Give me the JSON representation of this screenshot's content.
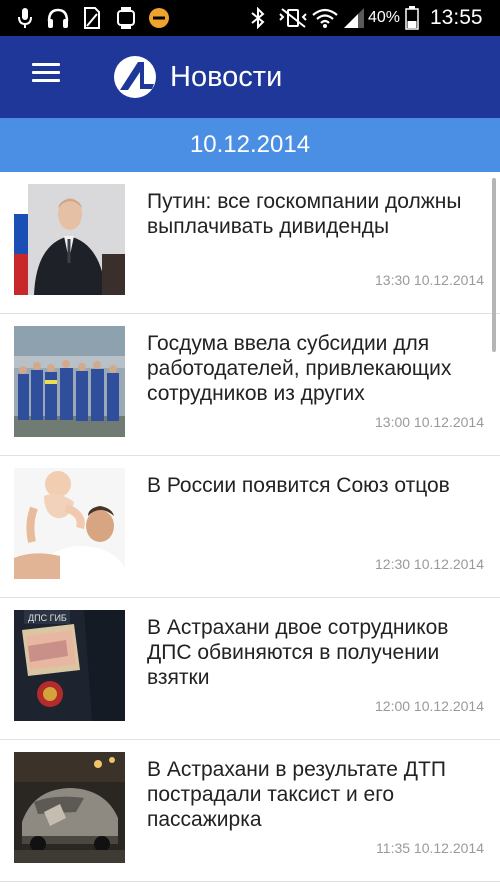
{
  "status_bar": {
    "battery": "40%",
    "time": "13:55",
    "icons": [
      "mic-icon",
      "headset-icon",
      "sim-icon",
      "watch-icon",
      "do-not-disturb-icon",
      "bluetooth-icon",
      "vibrate-off-icon",
      "wifi-icon",
      "signal-icon",
      "battery-icon"
    ]
  },
  "app_bar": {
    "title": "Новости",
    "menu_icon": "hamburger-menu-icon",
    "logo": "app-logo"
  },
  "date_header": "10.12.2014",
  "news": [
    {
      "title": "Путин: все госкомпании должны выплачивать дивиденды",
      "time": "13:30 10.12.2014",
      "image": "putin-speech-photo"
    },
    {
      "title": "Госдума ввела субсидии для работодателей, привлекающих сотрудников из других",
      "time": "13:00 10.12.2014",
      "image": "workers-group-photo"
    },
    {
      "title": "В России появится Союз отцов",
      "time": "12:30 10.12.2014",
      "image": "father-baby-photo"
    },
    {
      "title": "В Астрахани двое сотрудников ДПС обвиняются в получении взятки",
      "time": "12:00 10.12.2014",
      "image": "police-money-photo"
    },
    {
      "title": "В Астрахани в результате ДТП пострадали таксист и его пассажирка",
      "time": "11:35 10.12.2014",
      "image": "car-crash-photo"
    }
  ],
  "colors": {
    "app_bar": "#1e3799",
    "date_bar": "#4a8fe4",
    "headline": "#222222",
    "timestamp": "#9a9a9a"
  }
}
